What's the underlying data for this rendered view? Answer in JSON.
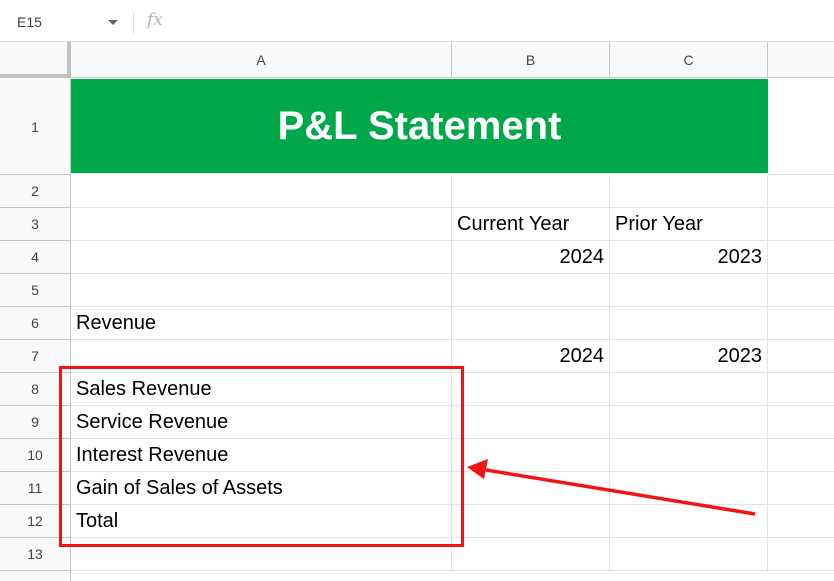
{
  "formula_bar": {
    "name_box": "E15",
    "fx_label": "fx",
    "formula": ""
  },
  "columns": [
    "A",
    "B",
    "C"
  ],
  "rows": [
    "1",
    "2",
    "3",
    "4",
    "5",
    "6",
    "7",
    "8",
    "9",
    "10",
    "11",
    "12",
    "13"
  ],
  "sheet": {
    "title": "P&L Statement",
    "b3": "Current Year",
    "c3": "Prior Year",
    "b4": "2024",
    "c4": "2023",
    "a6": "Revenue",
    "b7": "2024",
    "c7": "2023",
    "a8": "Sales Revenue",
    "a9": "Service Revenue",
    "a10": "Interest Revenue",
    "a11": "Gain of Sales of Assets",
    "a12": "Total"
  },
  "colors": {
    "title_fill": "#00a84a",
    "title_text": "#ffffff",
    "annotation": "#f21313"
  }
}
